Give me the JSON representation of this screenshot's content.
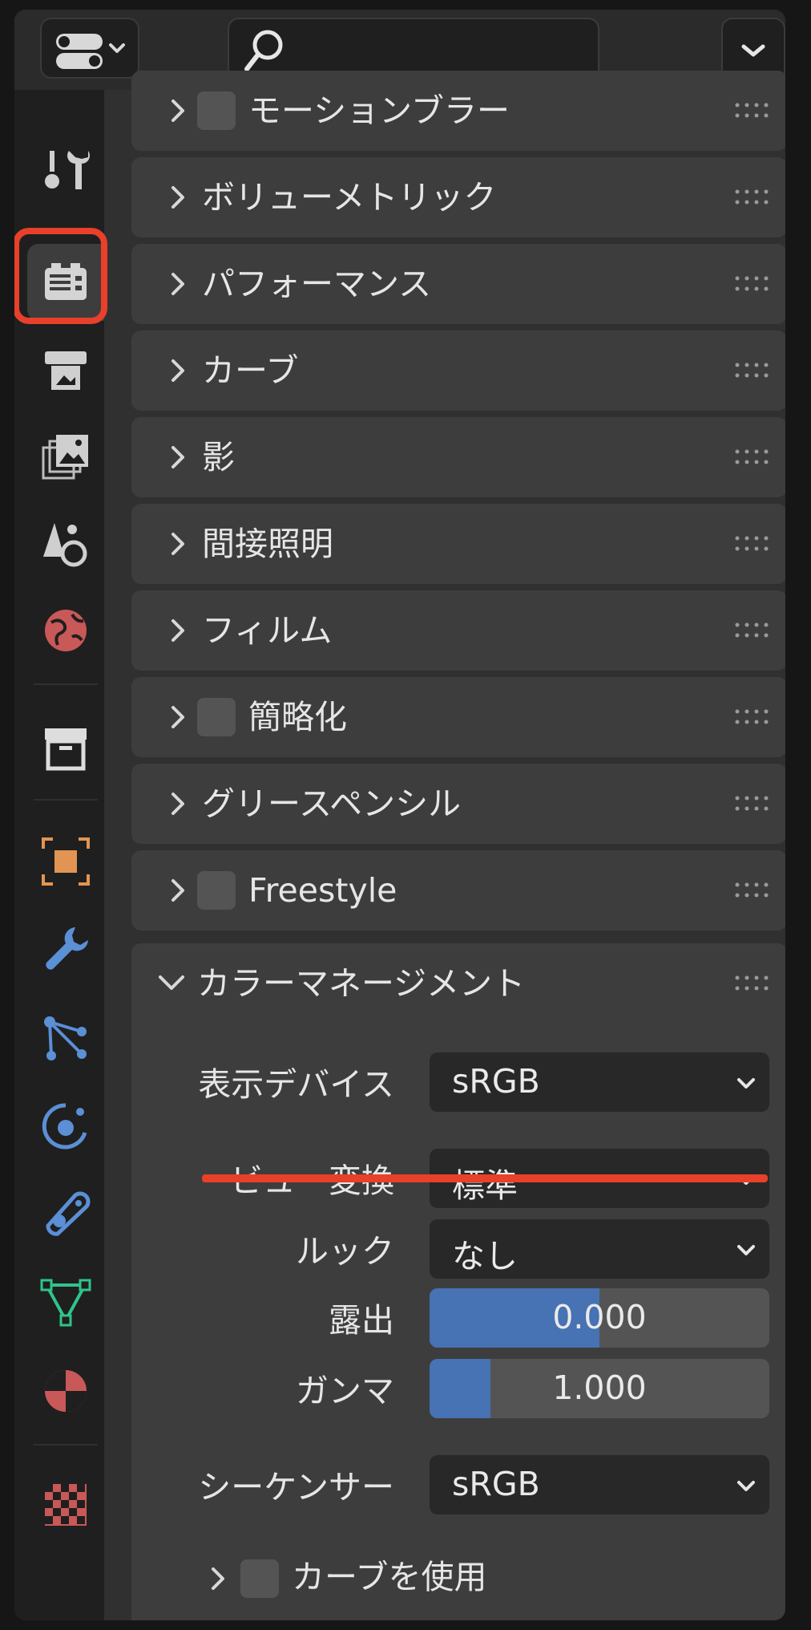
{
  "header": {
    "editor_type_icon": "properties-editor-icon",
    "search_placeholder": "",
    "search_icon": "search-icon",
    "options_icon": "chevron-down-icon"
  },
  "tabs": {
    "items": [
      {
        "name": "tool",
        "icon": "tool-icon",
        "color": "#cccccc"
      },
      {
        "name": "render",
        "icon": "render-camera-icon",
        "color": "#cccccc",
        "active": true
      },
      {
        "name": "output",
        "icon": "output-printer-icon",
        "color": "#cccccc"
      },
      {
        "name": "view-layer",
        "icon": "view-layer-icon",
        "color": "#cccccc"
      },
      {
        "name": "scene",
        "icon": "scene-icon",
        "color": "#cccccc"
      },
      {
        "name": "world",
        "icon": "world-icon",
        "color": "#d45d5d"
      },
      {
        "name": "collection",
        "icon": "collection-icon",
        "color": "#dddddd"
      },
      {
        "name": "object",
        "icon": "object-icon",
        "color": "#e09050"
      },
      {
        "name": "modifiers",
        "icon": "wrench-icon",
        "color": "#5b8fd6"
      },
      {
        "name": "particles",
        "icon": "particles-icon",
        "color": "#5b8fd6"
      },
      {
        "name": "physics",
        "icon": "physics-icon",
        "color": "#5b8fd6"
      },
      {
        "name": "constraints",
        "icon": "constraints-icon",
        "color": "#5b8fd6"
      },
      {
        "name": "data",
        "icon": "mesh-data-icon",
        "color": "#2fc48b"
      },
      {
        "name": "material",
        "icon": "material-icon",
        "color": "#d45d5d"
      },
      {
        "name": "texture",
        "icon": "texture-icon",
        "color": "#d45d5d"
      }
    ]
  },
  "panels": [
    {
      "label": "モーションブラー",
      "checkbox": true
    },
    {
      "label": "ボリューメトリック",
      "checkbox": false
    },
    {
      "label": "パフォーマンス",
      "checkbox": false
    },
    {
      "label": "カーブ",
      "checkbox": false
    },
    {
      "label": "影",
      "checkbox": false
    },
    {
      "label": "間接照明",
      "checkbox": false
    },
    {
      "label": "フィルム",
      "checkbox": false
    },
    {
      "label": "簡略化",
      "checkbox": true
    },
    {
      "label": "グリースペンシル",
      "checkbox": false
    },
    {
      "label": "Freestyle",
      "checkbox": true
    }
  ],
  "color_management": {
    "title": "カラーマネージメント",
    "display_device": {
      "label": "表示デバイス",
      "value": "sRGB"
    },
    "view_transform": {
      "label": "ビュー変換",
      "value": "標準"
    },
    "look": {
      "label": "ルック",
      "value": "なし"
    },
    "exposure": {
      "label": "露出",
      "value": "0.000",
      "fill": 0.5
    },
    "gamma": {
      "label": "ガンマ",
      "value": "1.000",
      "fill": 0.18
    },
    "sequencer": {
      "label": "シーケンサー",
      "value": "sRGB"
    },
    "use_curves": {
      "label": "カーブを使用"
    }
  },
  "colors": {
    "highlight": "#e8402a",
    "slider_fill": "#4772b3",
    "panel_bg": "#3d3d3d"
  }
}
